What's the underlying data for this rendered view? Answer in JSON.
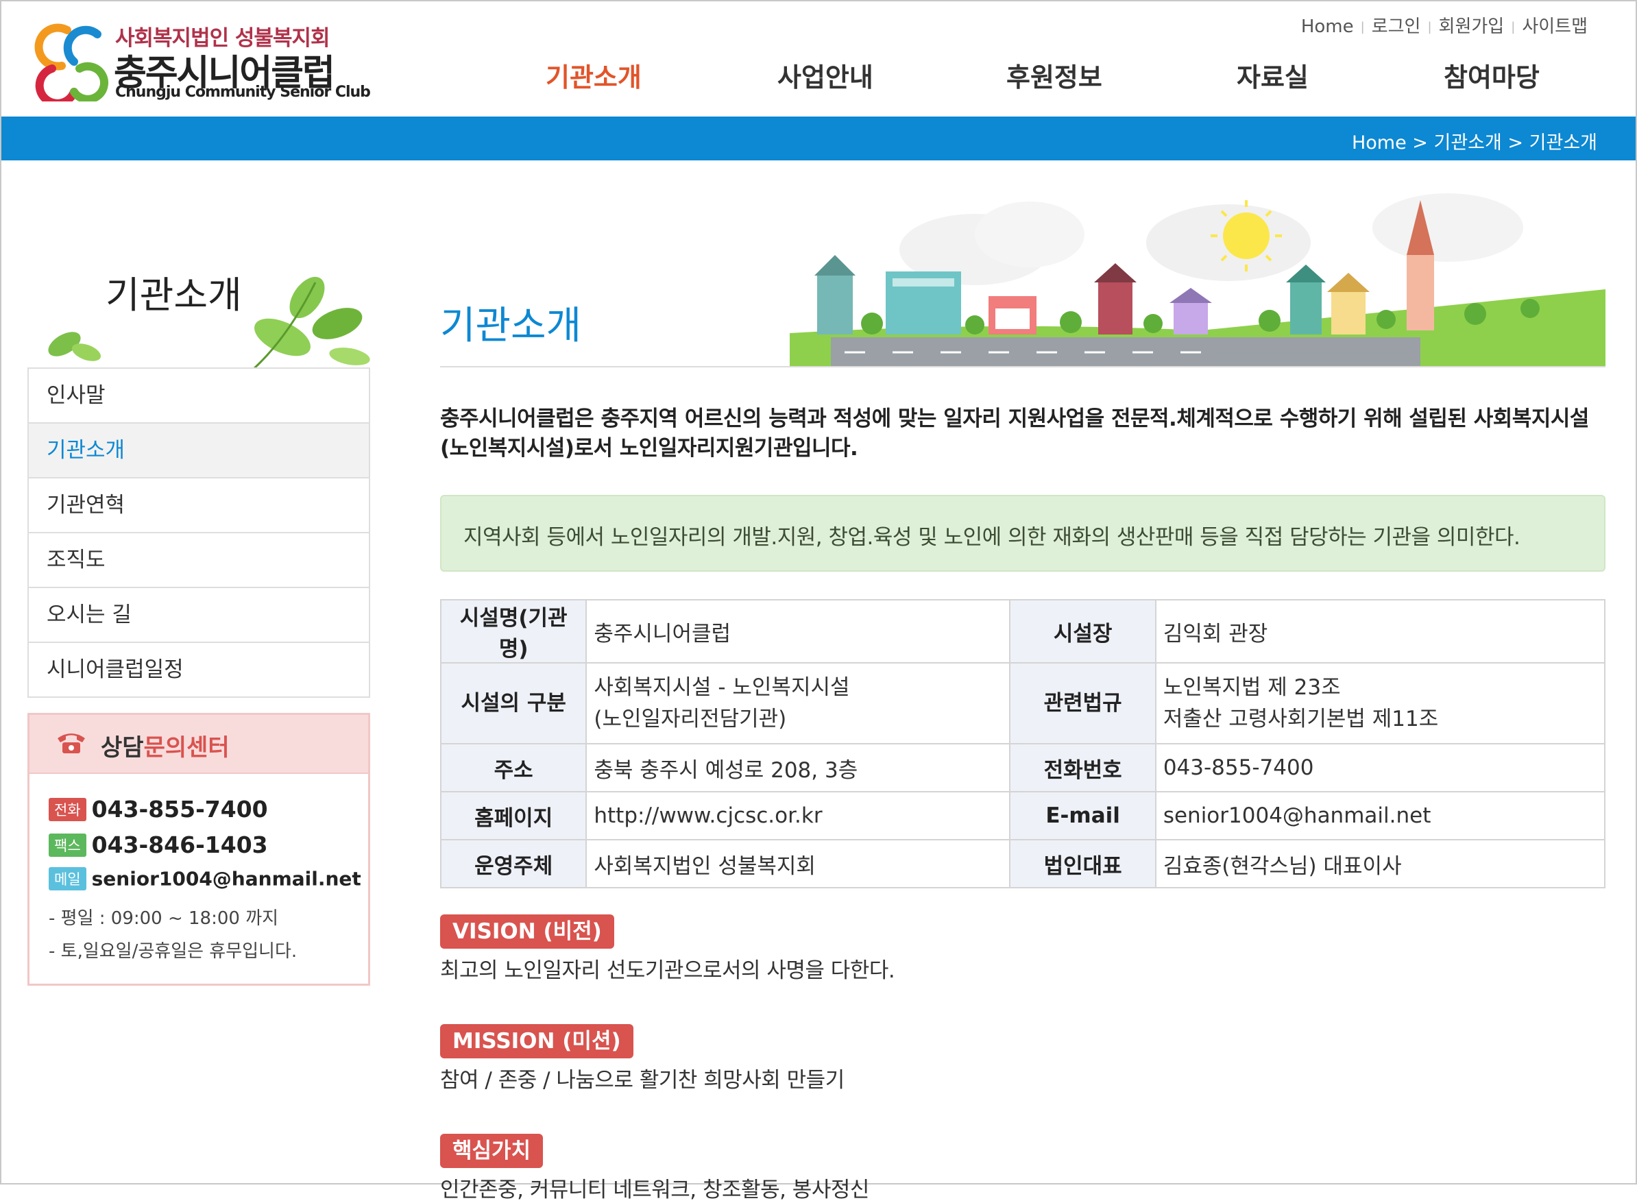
{
  "header": {
    "logo_sub": "사회복지법인 성불복지회",
    "logo_main": "충주시니어클럽",
    "logo_en": "Chungju Community Senior Club",
    "util": [
      "Home",
      "로그인",
      "회원가입",
      "사이트맵"
    ],
    "nav": [
      "기관소개",
      "사업안내",
      "후원정보",
      "자료실",
      "참여마당"
    ]
  },
  "breadcrumb": {
    "text": "Home > 기관소개 > 기관소개"
  },
  "sidebar": {
    "title": "기관소개",
    "items": [
      "인사말",
      "기관소개",
      "기관연혁",
      "조직도",
      "오시는 길",
      "시니어클럽일정"
    ],
    "active": "기관소개"
  },
  "consult": {
    "title_a": "상담",
    "title_b": "문의센터",
    "phone_badge": "전화",
    "phone": "043-855-7400",
    "fax_badge": "팩스",
    "fax": "043-846-1403",
    "mail_badge": "메일",
    "mail": "senior1004@hanmail.net",
    "hours1": "- 평일 : 09:00 ~ 18:00 까지",
    "hours2": "- 토,일요일/공휴일은 휴무입니다."
  },
  "content": {
    "title": "기관소개",
    "intro_line1": "충주시니어클럽은 충주지역 어르신의 능력과 적성에 맞는 일자리 지원사업을 전문적.체계적으로 수행하기 위해 설립된 사회복지시설",
    "intro_line2": "(노인복지시설)로서 노인일자리지원기관입니다.",
    "notice": "지역사회 등에서 노인일자리의 개발.지원, 창업.육성 및 노인에 의한 재화의 생산판매 등을 직접 담당하는 기관을 의미한다.",
    "table": {
      "name_label": "시설명(기관명)",
      "name": "충주시니어클럽",
      "head_label": "시설장",
      "head": "김익회 관장",
      "type_label": "시설의 구분",
      "type_line1": "사회복지시설 - 노인복지시설",
      "type_line2": "(노인일자리전담기관)",
      "law_label": "관련법규",
      "law_line1": "노인복지법 제 23조",
      "law_line2": "저출산 고령사회기본법 제11조",
      "addr_label": "주소",
      "addr": "충북 충주시 예성로 208, 3층",
      "tel_label": "전화번호",
      "tel": "043-855-7400",
      "web_label": "홈페이지",
      "web": "http://www.cjcsc.or.kr",
      "email_label": "E-mail",
      "email": "senior1004@hanmail.net",
      "op_label": "운영주체",
      "op": "사회복지법인 성불복지회",
      "rep_label": "법인대표",
      "rep": "김효종(현각스님) 대표이사"
    },
    "vision_tag": "VISION (비전)",
    "vision_text": "최고의 노인일자리 선도기관으로서의 사명을 다한다.",
    "mission_tag": "MISSION (미션)",
    "mission_text": "참여 / 존중 / 나눔으로 활기찬 희망사회 만들기",
    "core_tag": "핵심가치",
    "core_text": "인간존중, 커뮤니티 네트워크, 창조활동, 봉사정신"
  },
  "colors": {
    "accent_blue": "#0d88d2",
    "nav_active": "#e2542a",
    "tag_red": "#d9534f",
    "notice_green": "#dff0d8"
  }
}
